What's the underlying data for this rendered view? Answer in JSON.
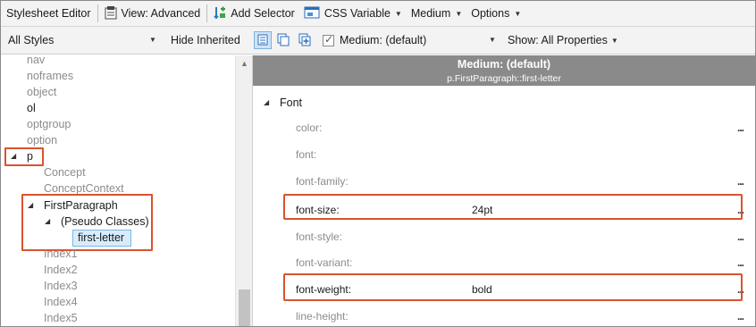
{
  "toolbar": {
    "title": "Stylesheet Editor",
    "view_label": "View: Advanced",
    "add_selector_label": "Add Selector",
    "css_variable_label": "CSS Variable",
    "medium_label": "Medium",
    "options_label": "Options"
  },
  "filterbar": {
    "styles_select": "All Styles",
    "hide_inherited_label": "Hide Inherited",
    "medium_select": "Medium: (default)",
    "show_properties_label": "Show: All Properties"
  },
  "tree": {
    "items": [
      {
        "label": "nav"
      },
      {
        "label": "noframes"
      },
      {
        "label": "object"
      },
      {
        "label": "ol"
      },
      {
        "label": "optgroup"
      },
      {
        "label": "option"
      },
      {
        "label": "p"
      },
      {
        "label": "Concept"
      },
      {
        "label": "ConceptContext"
      },
      {
        "label": "FirstParagraph"
      },
      {
        "label": "(Pseudo Classes)"
      },
      {
        "label": "first-letter"
      },
      {
        "label": "Index1"
      },
      {
        "label": "Index2"
      },
      {
        "label": "Index3"
      },
      {
        "label": "Index4"
      },
      {
        "label": "Index5"
      }
    ]
  },
  "panel": {
    "header_title": "Medium: (default)",
    "header_selector": "p.FirstParagraph::first-letter",
    "group_label": "Font",
    "more_label": "...",
    "properties": [
      {
        "name": "color:",
        "value": ""
      },
      {
        "name": "font:",
        "value": ""
      },
      {
        "name": "font-family:",
        "value": ""
      },
      {
        "name": "font-size:",
        "value": "24pt"
      },
      {
        "name": "font-style:",
        "value": ""
      },
      {
        "name": "font-variant:",
        "value": ""
      },
      {
        "name": "font-weight:",
        "value": "bold"
      },
      {
        "name": "line-height:",
        "value": ""
      }
    ]
  },
  "colors": {
    "highlight": "#d9532f",
    "selection_fill": "#d8ecfb",
    "header_band": "#8a8a8a"
  }
}
